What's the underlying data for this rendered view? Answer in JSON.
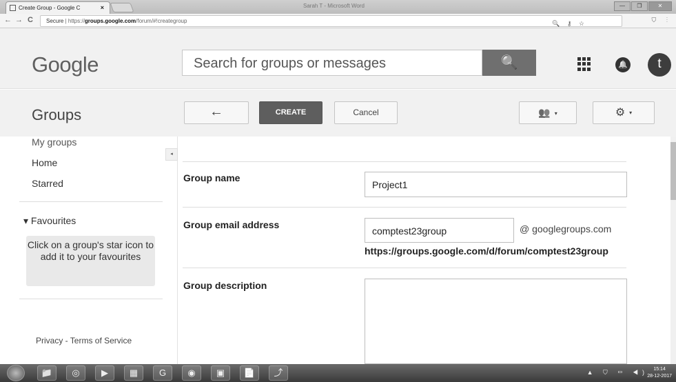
{
  "browser": {
    "tab_title": "Create Group - Google C",
    "tab_close": "×",
    "window_title": "Sarah T - Microsoft Word",
    "url_secure": "Secure",
    "url_prefix": "https://",
    "url_host": "groups.google.com",
    "url_path": "/forum/#!creategroup",
    "omnibox_icons": "🔍 ⚷ ☆",
    "extension_icons": "⛉ ⋮",
    "nav": {
      "back": "←",
      "forward": "→",
      "reload": "C"
    },
    "window_controls": [
      "—",
      "❐",
      "✕"
    ]
  },
  "header": {
    "logo": "Google",
    "search_placeholder": "Search for groups or messages",
    "search_icon": "🔍",
    "notifications_icon": "🔔",
    "avatar_letter": "t"
  },
  "toolbar": {
    "app_title": "Groups",
    "back_label": "←",
    "create_label": "CREATE",
    "cancel_label": "Cancel",
    "members_label": "👥",
    "settings_label": "⚙",
    "caret": "▾"
  },
  "sidebar": {
    "collapse_icon": "◂",
    "items": [
      "My groups",
      "Home",
      "Starred"
    ],
    "favourites_heading": "▾ Favourites",
    "favourites_hint": "Click on a group's star icon to add it to your favourites",
    "footer": "Privacy - Terms of Service"
  },
  "form": {
    "group_name_label": "Group name",
    "group_name_value": "Project1",
    "email_label": "Group email address",
    "email_value": "comptest23group",
    "email_suffix": "@ googlegroups.com",
    "group_url": "https://groups.google.com/d/forum/comptest23group",
    "description_label": "Group description",
    "description_value": ""
  },
  "taskbar": {
    "icons": [
      "📁",
      "◎",
      "▶",
      "▦",
      "G",
      "◉",
      "▣",
      "📄",
      "⤴"
    ],
    "tray": "▲ ⛉ ▭ ◀)",
    "clock_time": "15:14",
    "clock_date": "28-12-2017"
  }
}
